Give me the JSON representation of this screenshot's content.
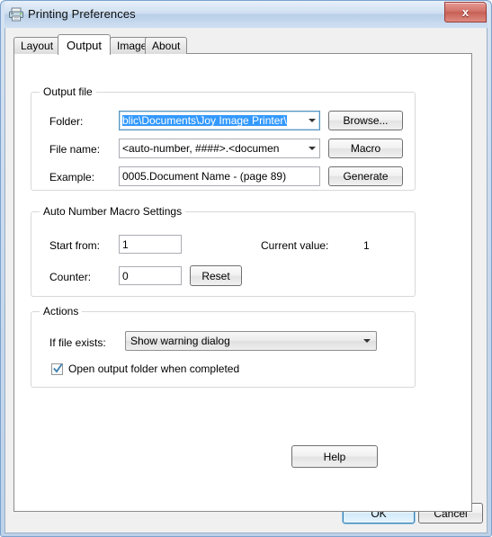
{
  "window": {
    "title": "Printing Preferences",
    "icon": "printer-icon",
    "close_label": "x"
  },
  "tabs": [
    {
      "label": "Layout",
      "active": false
    },
    {
      "label": "Output",
      "active": true
    },
    {
      "label": "Image",
      "active": false
    },
    {
      "label": "About",
      "active": false
    }
  ],
  "output_file": {
    "group_label": "Output file",
    "folder": {
      "label": "Folder:",
      "value": "blic\\Documents\\Joy Image Printer\\",
      "selected": true,
      "button": "Browse..."
    },
    "file_name": {
      "label": "File name:",
      "value": "<auto-number, ####>.<documen",
      "button": "Macro"
    },
    "example": {
      "label": "Example:",
      "value": "0005.Document Name - (page 89)",
      "button": "Generate"
    }
  },
  "auto_number": {
    "group_label": "Auto Number Macro Settings",
    "start_from": {
      "label": "Start from:",
      "value": "1"
    },
    "current_value": {
      "label": "Current value:",
      "value": "1"
    },
    "counter": {
      "label": "Counter:",
      "value": "0",
      "button": "Reset"
    }
  },
  "actions": {
    "group_label": "Actions",
    "if_file_exists": {
      "label": "If file exists:",
      "selected": "Show warning dialog"
    },
    "open_output_folder": {
      "label": "Open output folder when completed",
      "checked": true
    }
  },
  "help_button": "Help",
  "footer": {
    "ok": "OK",
    "cancel": "Cancel"
  },
  "colors": {
    "selection_blue": "#3399ff",
    "title_blue": "#b9cfe8",
    "close_red": "#c75f55",
    "default_border": "#3c7fb1"
  }
}
